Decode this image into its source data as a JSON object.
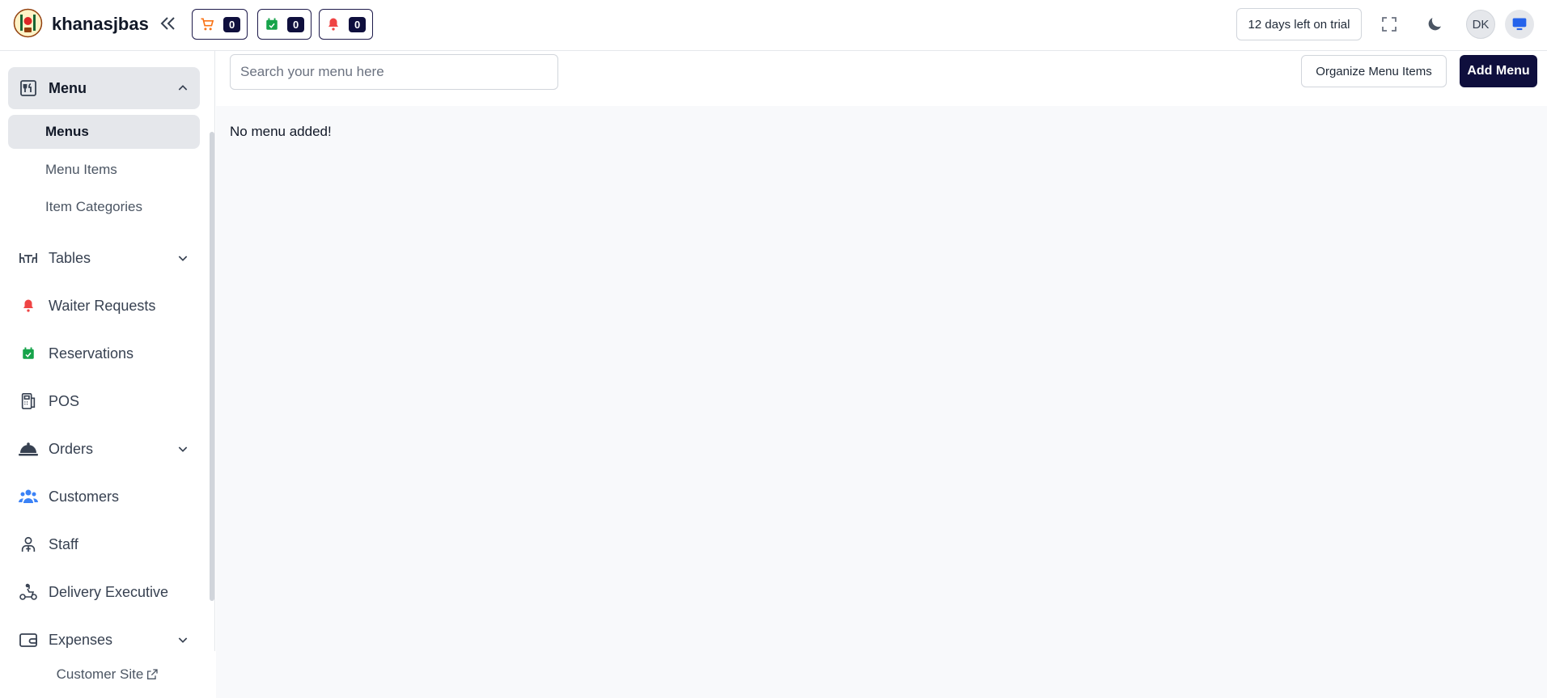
{
  "header": {
    "brand": "khanasjbas",
    "cart_count": "0",
    "reservation_count": "0",
    "notification_count": "0",
    "trial_text": "12 days left on trial",
    "avatar_initials": "DK"
  },
  "sidebar": {
    "menu": {
      "label": "Menu",
      "subitems": [
        "Menus",
        "Menu Items",
        "Item Categories"
      ]
    },
    "items": [
      {
        "label": "Tables",
        "icon": "table-icon"
      },
      {
        "label": "Waiter Requests",
        "icon": "bell-icon"
      },
      {
        "label": "Reservations",
        "icon": "calendar-check-icon"
      },
      {
        "label": "POS",
        "icon": "pos-icon"
      },
      {
        "label": "Orders",
        "icon": "cloche-icon"
      },
      {
        "label": "Customers",
        "icon": "users-icon"
      },
      {
        "label": "Staff",
        "icon": "staff-icon"
      },
      {
        "label": "Delivery Executive",
        "icon": "scooter-icon"
      },
      {
        "label": "Expenses",
        "icon": "wallet-icon"
      }
    ],
    "customer_site": "Customer Site"
  },
  "main": {
    "search_placeholder": "Search your menu here",
    "organize_button": "Organize Menu Items",
    "add_button": "Add Menu",
    "empty_message": "No menu added!"
  },
  "colors": {
    "accent_dark": "#0f0f3d",
    "cart_orange": "#f97316",
    "reservation_green": "#16a34a",
    "bell_red": "#ef4444",
    "customers_blue": "#3b82f6"
  }
}
